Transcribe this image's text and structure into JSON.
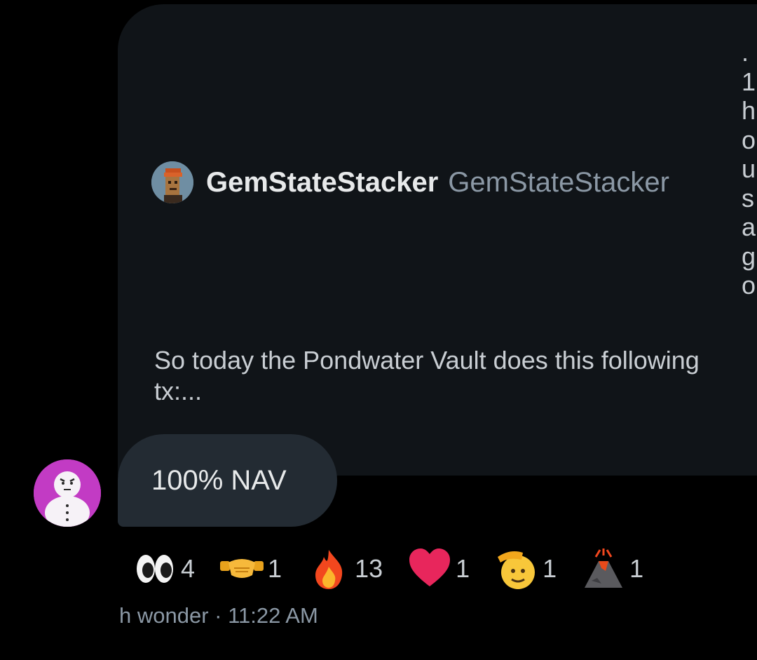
{
  "quote": {
    "author_name": "GemStateStacker",
    "author_handle": "GemStateStacker",
    "side_fragments": [
      ".",
      "1",
      "h",
      "o",
      "u",
      "s",
      "a",
      "g",
      "o"
    ],
    "text_line1": "So today the Pondwater Vault does this following",
    "text_line2": "tx:..."
  },
  "message": {
    "text": "100% NAV",
    "sender": "h wonder",
    "time": "11:22 AM",
    "separator": "·"
  },
  "reactions": [
    {
      "icon": "eyes-icon",
      "count": "4"
    },
    {
      "icon": "handshake-icon",
      "count": "1"
    },
    {
      "icon": "fire-icon",
      "count": "13"
    },
    {
      "icon": "heart-icon",
      "count": "1"
    },
    {
      "icon": "saluting-face-icon",
      "count": "1"
    },
    {
      "icon": "volcano-icon",
      "count": "1"
    }
  ],
  "colors": {
    "background": "#000000",
    "quote_card": "#101418",
    "bubble": "#232b33",
    "sender_avatar": "#c23bc4",
    "muted_text": "#8b98a5"
  }
}
